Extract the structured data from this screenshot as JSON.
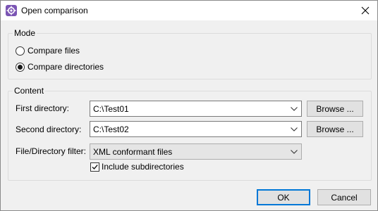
{
  "window": {
    "title": "Open comparison",
    "app_icon": "app-logo-icon",
    "close_icon": "close-icon"
  },
  "mode": {
    "legend": "Mode",
    "options": [
      {
        "label": "Compare files",
        "checked": false
      },
      {
        "label": "Compare directories",
        "checked": true
      }
    ]
  },
  "content": {
    "legend": "Content",
    "first_directory": {
      "label": "First directory:",
      "value": "C:\\Test01",
      "browse_label": "Browse ..."
    },
    "second_directory": {
      "label": "Second directory:",
      "value": "C:\\Test02",
      "browse_label": "Browse ..."
    },
    "filter": {
      "label": "File/Directory filter:",
      "value": "XML conformant files"
    },
    "include_subdirectories": {
      "label": "Include subdirectories",
      "checked": true
    }
  },
  "footer": {
    "ok_label": "OK",
    "cancel_label": "Cancel"
  },
  "colors": {
    "accent": "#0078d7",
    "app_icon": "#7b55b4"
  }
}
